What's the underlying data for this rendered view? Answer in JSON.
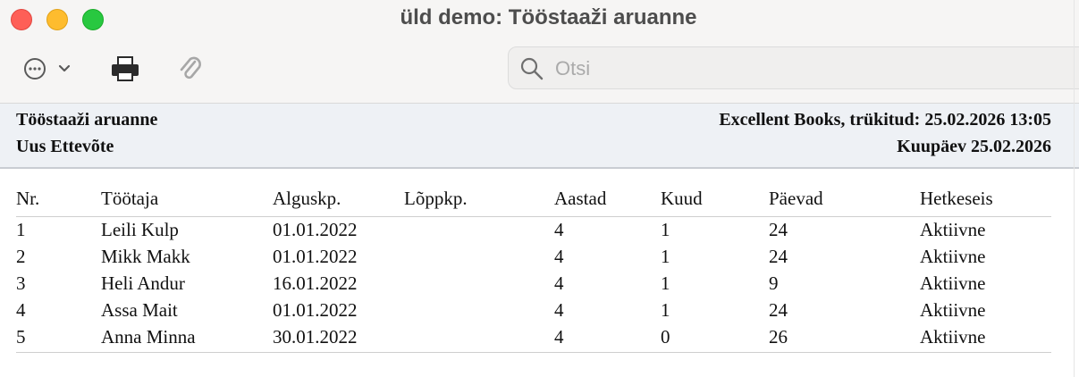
{
  "window": {
    "title": "üld demo: Tööstaaži aruanne"
  },
  "toolbar": {
    "more_icon": "ellipsis-circle-icon",
    "more_chevron_icon": "chevron-down-icon",
    "print_icon": "printer-icon",
    "attach_icon": "paperclip-icon"
  },
  "search": {
    "placeholder": "Otsi",
    "value": ""
  },
  "report": {
    "title": "Tööstaaži aruanne",
    "company": "Uus Ettevõte",
    "printed": "Excellent Books, trükitud: 25.02.2026 13:05",
    "date": "Kuupäev 25.02.2026"
  },
  "table": {
    "headers": [
      "Nr.",
      "Töötaja",
      "Alguskp.",
      "Lõppkp.",
      "Aastad",
      "Kuud",
      "Päevad",
      "Hetkeseis"
    ],
    "rows": [
      [
        "1",
        "Leili Kulp",
        "01.01.2022",
        "",
        "4",
        "1",
        "24",
        "Aktiivne"
      ],
      [
        "2",
        "Mikk Makk",
        "01.01.2022",
        "",
        "4",
        "1",
        "24",
        "Aktiivne"
      ],
      [
        "3",
        "Heli Andur",
        "16.01.2022",
        "",
        "4",
        "1",
        "9",
        "Aktiivne"
      ],
      [
        "4",
        "Assa Mait",
        "01.01.2022",
        "",
        "4",
        "1",
        "24",
        "Aktiivne"
      ],
      [
        "5",
        "Anna Minna",
        "30.01.2022",
        "",
        "4",
        "0",
        "26",
        "Aktiivne"
      ]
    ]
  },
  "colors": {
    "close": "#fe5f57",
    "minimize": "#febc2e",
    "maximize": "#28c840",
    "header_band": "#eef1f5"
  }
}
